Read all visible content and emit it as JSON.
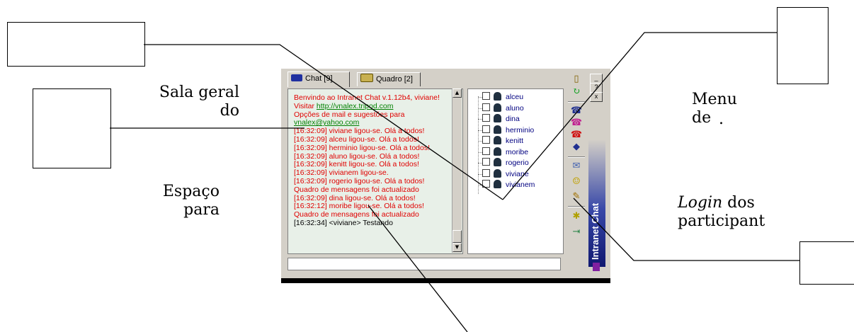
{
  "annotations": {
    "sala": "Sala geral do",
    "espaco": "Espaço para",
    "menu": "Menu de",
    "menu_dot": ".",
    "login_italic": "Login",
    "login_rest": "dos participant"
  },
  "tabs": [
    {
      "label": "Chat [9]"
    },
    {
      "label": "Quadro [2]"
    }
  ],
  "chat_log": [
    {
      "text": "Benvindo ao Intranet Chat v.1.12b4, viviane!",
      "style": "red"
    },
    {
      "text": "Visitar",
      "style": "red",
      "link": "http://vnalex.tripod.com"
    },
    {
      "text": "Opções de mail e sugestões para",
      "style": "red"
    },
    {
      "text": "vnalex@yahoo.com",
      "style": "green"
    },
    {
      "text": "[16:32:09] viviane ligou-se. Olá a todos!",
      "style": "red"
    },
    {
      "text": "[16:32:09] alceu ligou-se. Olá a todos!",
      "style": "red"
    },
    {
      "text": "[16:32:09] herminio ligou-se. Olá a todos!",
      "style": "red"
    },
    {
      "text": "[16:32:09] aluno ligou-se. Olá a todos!",
      "style": "red"
    },
    {
      "text": "[16:32:09] kenitt ligou-se. Olá a todos!",
      "style": "red"
    },
    {
      "text": "[16:32:09] vivianem ligou-se.",
      "style": "red"
    },
    {
      "text": "[16:32:09] rogerio ligou-se. Olá a todos!",
      "style": "red"
    },
    {
      "text": "Quadro de mensagens foi actualizado",
      "style": "red"
    },
    {
      "text": "[16:32:09] dina ligou-se. Olá a todos!",
      "style": "red"
    },
    {
      "text": "[16:32:12] moribe ligou-se. Olá a todos!",
      "style": "red"
    },
    {
      "text": "Quadro de mensagens foi actualizado",
      "style": "red"
    },
    {
      "text": "[16:32:34] <viviane> Testando",
      "style": "black"
    }
  ],
  "users": [
    "alceu",
    "aluno",
    "dina",
    "herminio",
    "kenitt",
    "moribe",
    "rogerio",
    "viviane",
    "vivianem"
  ],
  "sidebar_buttons": [
    "new-icon",
    "refresh-icon",
    "phone-icon",
    "phone-pink-icon",
    "phone-red-icon",
    "eraser-icon",
    "mail-icon",
    "smiley-icon",
    "edit-icon",
    "bulb-icon",
    "exit-icon"
  ],
  "window_controls": [
    "_",
    "?",
    "x"
  ],
  "brand": "Intranet Chat",
  "colors": {
    "chat_red": "#e00000",
    "link_green": "#008000",
    "user_blue": "#000080",
    "brand_blue": "#3848a8"
  }
}
